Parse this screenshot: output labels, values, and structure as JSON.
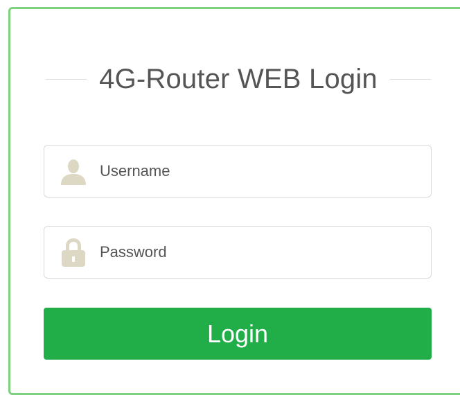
{
  "login": {
    "title": "4G-Router WEB Login",
    "username": {
      "placeholder": "Username",
      "value": "",
      "icon": "user-icon"
    },
    "password": {
      "placeholder": "Password",
      "value": "",
      "icon": "lock-icon"
    },
    "submit_label": "Login"
  },
  "colors": {
    "frame_border": "#7fd17f",
    "button_bg": "#21ad47",
    "icon": "#dcd8c4",
    "title_text": "#555555"
  }
}
